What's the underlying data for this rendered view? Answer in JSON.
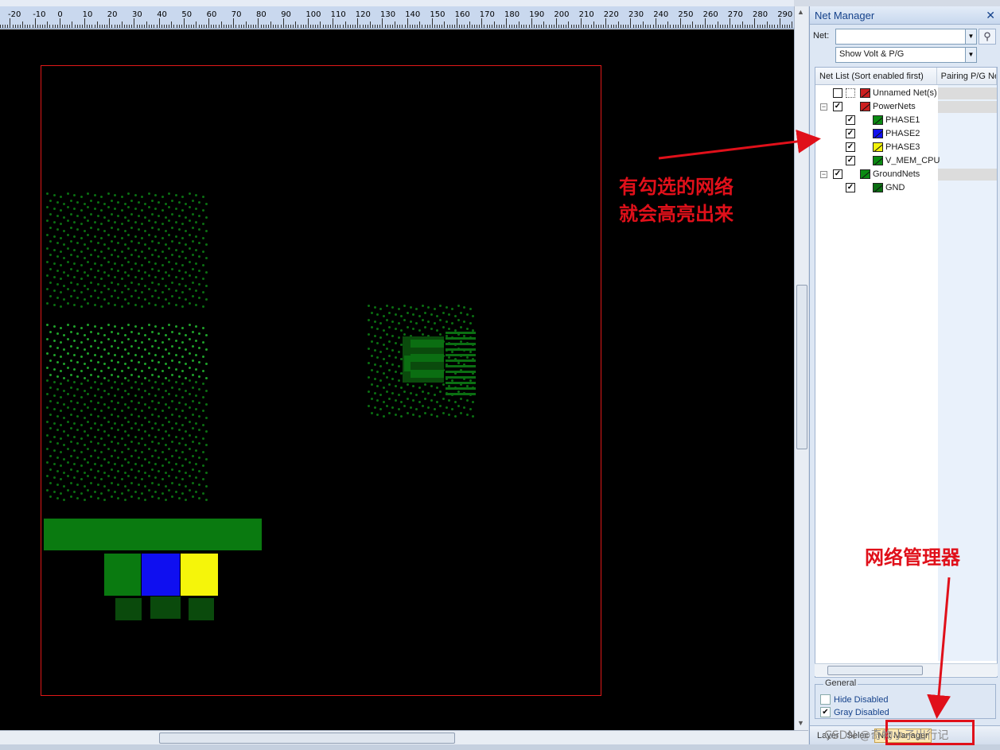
{
  "ruler": {
    "labels": [
      "-20",
      "-10",
      "0",
      "10",
      "20",
      "30",
      "40",
      "50",
      "60",
      "70",
      "80",
      "90",
      "100",
      "110",
      "120",
      "130",
      "140",
      "150",
      "160",
      "170",
      "180",
      "190",
      "200",
      "210",
      "220",
      "230",
      "240",
      "250",
      "260",
      "270",
      "280",
      "290"
    ]
  },
  "panel": {
    "title": "Net Manager",
    "close_icon": "✕",
    "net_label": "Net:",
    "net_value": "",
    "show_filter": "Show Volt & P/G",
    "columns": [
      "Net List (Sort enabled first)",
      "Pairing P/G Net"
    ],
    "tree": [
      {
        "label": "Unnamed Net(s)",
        "checked": false,
        "level": 0,
        "swatch": "#cc1f1f"
      },
      {
        "label": "PowerNets",
        "checked": true,
        "level": 0,
        "expander": "−",
        "swatch": "#cc1f1f"
      },
      {
        "label": "PHASE1",
        "checked": true,
        "level": 1,
        "swatch": "#0a8a12"
      },
      {
        "label": "PHASE2",
        "checked": true,
        "level": 1,
        "swatch": "#1010ee"
      },
      {
        "label": "PHASE3",
        "checked": true,
        "level": 1,
        "swatch": "#f2f20a"
      },
      {
        "label": "V_MEM_CPU",
        "checked": true,
        "level": 1,
        "swatch": "#0a8a12"
      },
      {
        "label": "GroundNets",
        "checked": true,
        "level": 0,
        "expander": "−",
        "swatch": "#0a8a12"
      },
      {
        "label": "GND",
        "checked": true,
        "level": 1,
        "swatch": "#0a6e12"
      }
    ],
    "general": {
      "legend": "General",
      "hide_disabled": {
        "label": "Hide Disabled",
        "checked": false
      },
      "gray_disabled": {
        "label": "Gray Disabled",
        "checked": true
      }
    },
    "tabs": [
      "Layer",
      "Selec",
      "Net Manager"
    ]
  },
  "annotations": {
    "checked_note_line1": "有勾选的网络",
    "checked_note_line2": "就会高亮出来",
    "manager_note": "网络管理器"
  },
  "watermark": "CSDN @奇物小子出行记"
}
